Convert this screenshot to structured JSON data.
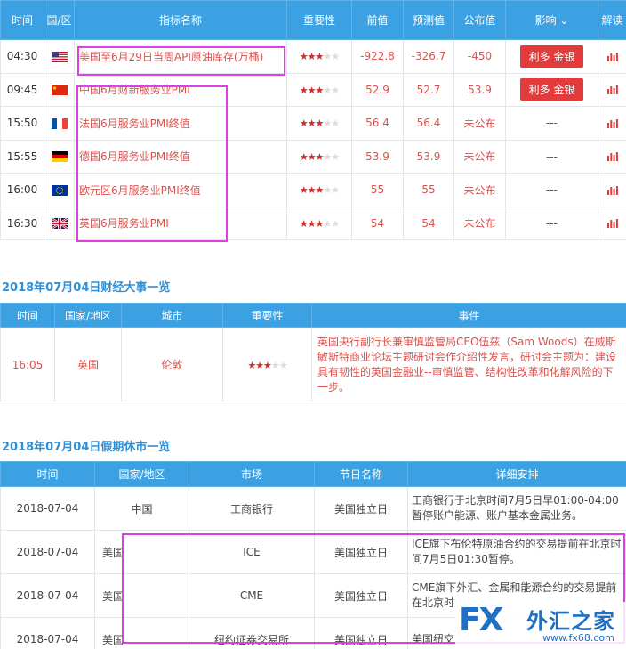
{
  "calendar": {
    "headers": {
      "time": "时间",
      "region": "国/区",
      "indicator": "指标名称",
      "importance": "重要性",
      "previous": "前值",
      "forecast": "预测值",
      "published": "公布值",
      "effect": "影响",
      "analysis": "解读"
    },
    "rows": [
      {
        "time": "04:30",
        "flag": "us-flag",
        "name": "美国至6月29日当周API原油库存(万桶)",
        "stars": 3,
        "previous": "-922.8",
        "forecast": "-326.7",
        "published": "-450",
        "effect": "利多 金银"
      },
      {
        "time": "09:45",
        "flag": "cn-flag",
        "name": "中国6月财新服务业PMI",
        "stars": 3,
        "previous": "52.9",
        "forecast": "52.7",
        "published": "53.9",
        "effect": "利多 金银"
      },
      {
        "time": "15:50",
        "flag": "fr-flag",
        "name": "法国6月服务业PMI终值",
        "stars": 3,
        "previous": "56.4",
        "forecast": "56.4",
        "published": "未公布",
        "effect": "---"
      },
      {
        "time": "15:55",
        "flag": "de-flag",
        "name": "德国6月服务业PMI终值",
        "stars": 3,
        "previous": "53.9",
        "forecast": "53.9",
        "published": "未公布",
        "effect": "---"
      },
      {
        "time": "16:00",
        "flag": "eu-flag",
        "name": "欧元区6月服务业PMI终值",
        "stars": 3,
        "previous": "55",
        "forecast": "55",
        "published": "未公布",
        "effect": "---"
      },
      {
        "time": "16:30",
        "flag": "uk-flag",
        "name": "英国6月服务业PMI",
        "stars": 3,
        "previous": "54",
        "forecast": "54",
        "published": "未公布",
        "effect": "---"
      }
    ]
  },
  "events_title": "2018年07月04日财经大事一览",
  "events": {
    "headers": {
      "time": "时间",
      "region": "国家/地区",
      "city": "城市",
      "importance": "重要性",
      "event": "事件"
    },
    "rows": [
      {
        "time": "16:05",
        "region": "英国",
        "city": "伦敦",
        "stars": 3,
        "event": "英国央行副行长兼审慎监管局CEO伍兹（Sam Woods）在威斯敏斯特商业论坛主题研讨会作介绍性发言，研讨会主题为：建设具有韧性的英国金融业--审慎监管、结构性改革和化解风险的下一步。"
      }
    ]
  },
  "holiday_title": "2018年07月04日假期休市一览",
  "holiday": {
    "headers": {
      "time": "时间",
      "region": "国家/地区",
      "market": "市场",
      "holiday": "节日名称",
      "detail": "详细安排"
    },
    "rows": [
      {
        "time": "2018-07-04",
        "region": "中国",
        "market": "工商银行",
        "holiday": "美国独立日",
        "detail": "工商银行于北京时间7月5日早01:00-04:00暂停账户能源、账户基本金属业务。"
      },
      {
        "time": "2018-07-04",
        "region": "美国",
        "market": "ICE",
        "holiday": "美国独立日",
        "detail": "ICE旗下布伦特原油合约的交易提前在北京时间7月5日01:30暂停。"
      },
      {
        "time": "2018-07-04",
        "region": "美国",
        "market": "CME",
        "holiday": "美国独立日",
        "detail": "CME旗下外汇、金属和能源合约的交易提前在北京时"
      },
      {
        "time": "2018-07-04",
        "region": "美国",
        "market": "纽约证券交易所",
        "holiday": "美国独立日",
        "detail": "美国纽交"
      }
    ]
  },
  "watermark": {
    "brand": "FX",
    "name": "外汇之家",
    "url": "www.fx68.com"
  },
  "colors": {
    "header_bg": "#3ba1e3",
    "accent_red": "#d9534f",
    "section_title": "#2f8fd6",
    "highlight": "#e03fe0",
    "brand": "#1f6fc4"
  }
}
